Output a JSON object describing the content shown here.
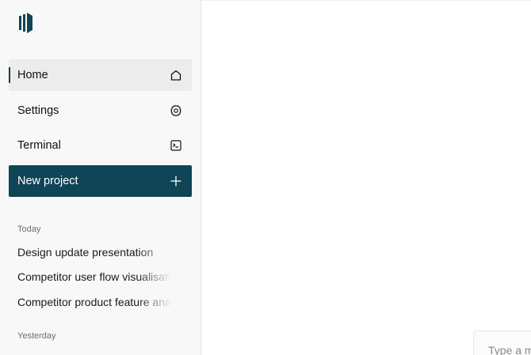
{
  "sidebar": {
    "logo_icon": "brand-logo-icon",
    "nav": [
      {
        "label": "Home",
        "icon": "home-icon"
      },
      {
        "label": "Settings",
        "icon": "gear-icon"
      },
      {
        "label": "Terminal",
        "icon": "terminal-icon"
      }
    ],
    "new_project": {
      "label": "New project",
      "icon": "plus-icon"
    },
    "sections": [
      {
        "label": "Today",
        "items": [
          "Design update presentation",
          "Competitor user flow visualisation",
          "Competitor product feature analysis"
        ]
      },
      {
        "label": "Yesterday",
        "items": []
      }
    ]
  },
  "composer": {
    "placeholder": "Type a message"
  },
  "colors": {
    "accent": "#0f4556",
    "sidebar_bg": "#f8f8f8",
    "active_bg": "#ececec"
  }
}
